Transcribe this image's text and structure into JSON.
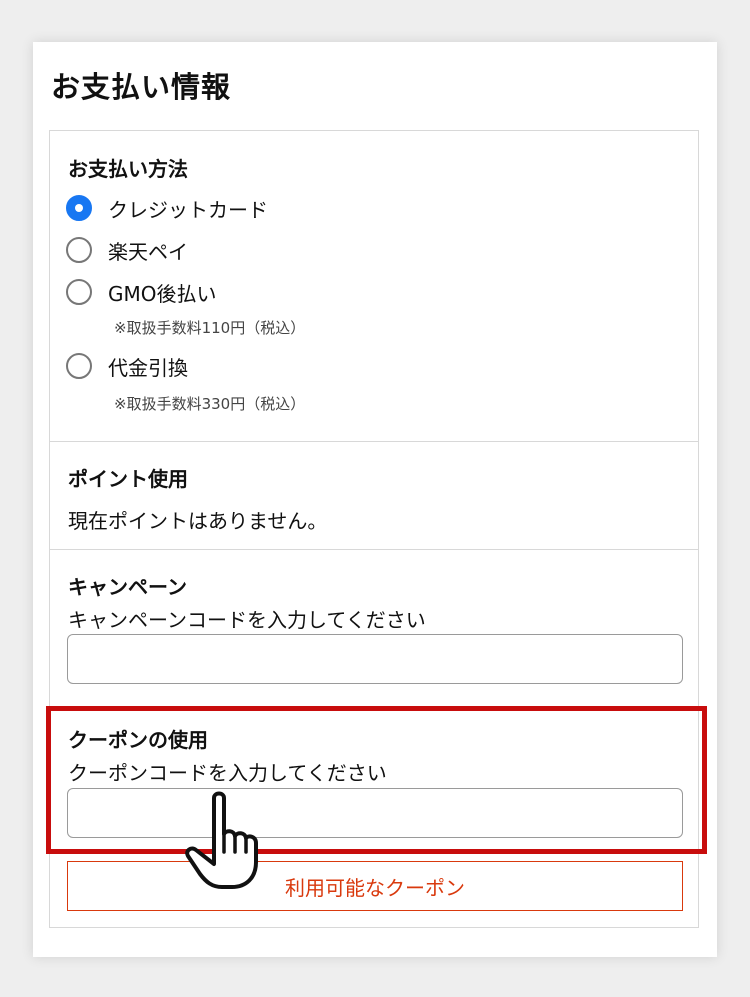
{
  "page": {
    "title": "お支払い情報"
  },
  "payment_method": {
    "title": "お支払い方法",
    "options": [
      {
        "label": "クレジットカード",
        "selected": true,
        "note": ""
      },
      {
        "label": "楽天ペイ",
        "selected": false,
        "note": ""
      },
      {
        "label": "GMO後払い",
        "selected": false,
        "note": "※取扱手数料110円（税込）"
      },
      {
        "label": "代金引換",
        "selected": false,
        "note": "※取扱手数料330円（税込）"
      }
    ]
  },
  "points": {
    "title": "ポイント使用",
    "message": "現在ポイントはありません。"
  },
  "campaign": {
    "title": "キャンペーン",
    "instruction": "キャンペーンコードを入力してください",
    "input_value": ""
  },
  "coupon": {
    "title": "クーポンの使用",
    "instruction": "クーポンコードを入力してください",
    "input_value": "",
    "available_button": "利用可能なクーポン"
  },
  "colors": {
    "radio_selected": "#1877f2",
    "coupon_button": "#d9390d",
    "highlight_frame": "#c80d0d"
  },
  "icons": {
    "pointer": "hand-pointer-icon"
  }
}
